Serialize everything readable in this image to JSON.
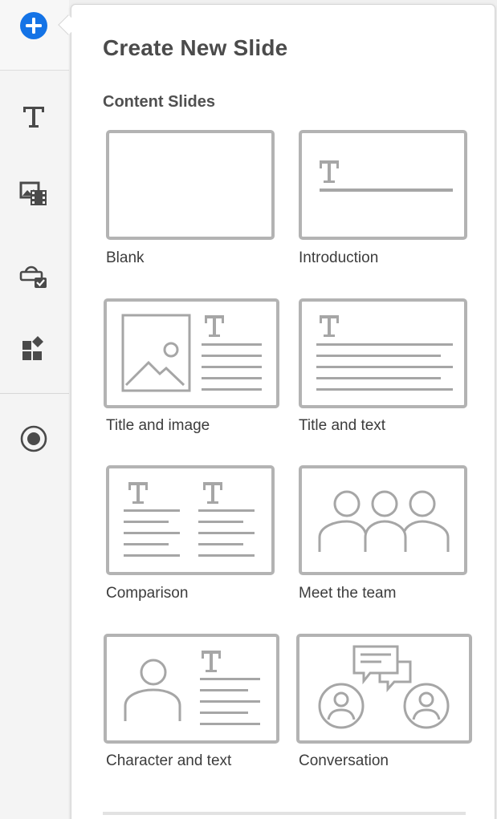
{
  "rail": {
    "items": [
      {
        "icon": "add-circle-icon",
        "accent": "#1473e6"
      },
      {
        "icon": "text-icon"
      },
      {
        "icon": "media-icon"
      },
      {
        "icon": "interaction-icon"
      },
      {
        "icon": "widgets-icon"
      },
      {
        "icon": "record-icon"
      }
    ]
  },
  "panel": {
    "title": "Create New Slide",
    "section": "Content Slides",
    "templates": [
      {
        "label": "Blank"
      },
      {
        "label": "Introduction"
      },
      {
        "label": "Title and image"
      },
      {
        "label": "Title and text"
      },
      {
        "label": "Comparison"
      },
      {
        "label": "Meet the team"
      },
      {
        "label": "Character and text"
      },
      {
        "label": "Conversation"
      }
    ]
  },
  "colors": {
    "accent": "#1473e6",
    "card_border": "#b3b3b3",
    "glyph": "#a6a6a6"
  }
}
